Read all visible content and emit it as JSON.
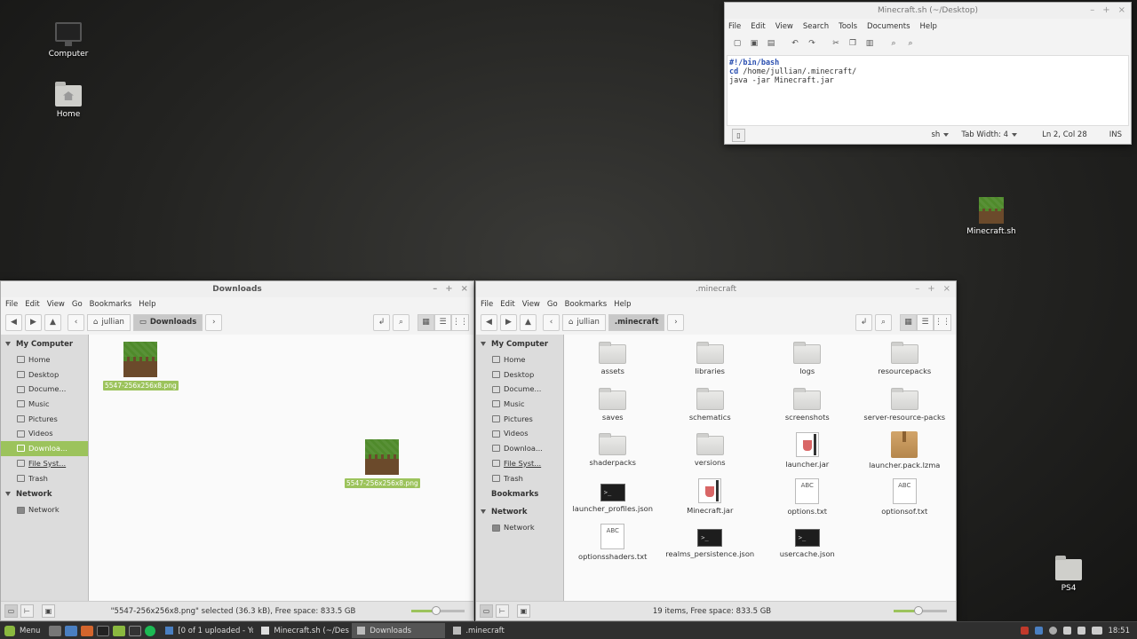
{
  "desktop": {
    "icons": {
      "computer": "Computer",
      "home": "Home",
      "minecraft_sh": "Minecraft.sh",
      "ps4": "PS4"
    }
  },
  "gedit": {
    "title": "Minecraft.sh (~/Desktop)",
    "menu": [
      "File",
      "Edit",
      "View",
      "Search",
      "Tools",
      "Documents",
      "Help"
    ],
    "code": {
      "line1": "#!/bin/bash",
      "line2_cmd": "cd",
      "line2_arg": " /home/jullian/.minecraft/",
      "line3": "java -jar Minecraft.jar"
    },
    "status": {
      "language": "sh",
      "tab_width": "Tab Width: 4",
      "position": "Ln 2, Col 28",
      "mode": "INS"
    }
  },
  "downloads_window": {
    "title": "Downloads",
    "menu": [
      "File",
      "Edit",
      "View",
      "Go",
      "Bookmarks",
      "Help"
    ],
    "breadcrumb": [
      "jullian",
      "Downloads"
    ],
    "sidebar": {
      "my_computer": "My Computer",
      "items": [
        "Home",
        "Desktop",
        "Docume...",
        "Music",
        "Pictures",
        "Videos",
        "Downloa...",
        "File Syst...",
        "Trash"
      ],
      "network_header": "Network",
      "network_items": [
        "Network"
      ]
    },
    "files": [
      "5547-256x256x8.png",
      "5547-256x256x8.png"
    ],
    "status": "\"5547-256x256x8.png\" selected (36.3 kB), Free space: 833.5 GB",
    "zoom_fraction": 0.47
  },
  "minecraft_window": {
    "title": ".minecraft",
    "menu": [
      "File",
      "Edit",
      "View",
      "Go",
      "Bookmarks",
      "Help"
    ],
    "breadcrumb": [
      "jullian",
      ".minecraft"
    ],
    "sidebar": {
      "my_computer": "My Computer",
      "items": [
        "Home",
        "Desktop",
        "Docume...",
        "Music",
        "Pictures",
        "Videos",
        "Downloa...",
        "File Syst...",
        "Trash"
      ],
      "bookmarks_header": "Bookmarks",
      "network_header": "Network",
      "network_items": [
        "Network"
      ]
    },
    "files": [
      {
        "name": "assets",
        "kind": "folder"
      },
      {
        "name": "libraries",
        "kind": "folder"
      },
      {
        "name": "logs",
        "kind": "folder"
      },
      {
        "name": "resourcepacks",
        "kind": "folder"
      },
      {
        "name": "saves",
        "kind": "folder"
      },
      {
        "name": "schematics",
        "kind": "folder"
      },
      {
        "name": "screenshots",
        "kind": "folder"
      },
      {
        "name": "server-resource-packs",
        "kind": "folder"
      },
      {
        "name": "shaderpacks",
        "kind": "folder"
      },
      {
        "name": "versions",
        "kind": "folder"
      },
      {
        "name": "launcher.jar",
        "kind": "jar"
      },
      {
        "name": "launcher.pack.lzma",
        "kind": "package"
      },
      {
        "name": "launcher_profiles.json",
        "kind": "terminal"
      },
      {
        "name": "Minecraft.jar",
        "kind": "jar"
      },
      {
        "name": "options.txt",
        "kind": "text"
      },
      {
        "name": "optionsof.txt",
        "kind": "text"
      },
      {
        "name": "optionsshaders.txt",
        "kind": "text"
      },
      {
        "name": "realms_persistence.json",
        "kind": "terminal"
      },
      {
        "name": "usercache.json",
        "kind": "terminal"
      }
    ],
    "status": "19 items, Free space: 833.5 GB",
    "zoom_fraction": 0.47
  },
  "taskbar": {
    "menu_label": "Menu",
    "tasks": [
      "[0 of 1 uploaded - Yo...",
      "Minecraft.sh (~/Des...",
      "Downloads",
      ".minecraft"
    ],
    "clock": "18:51"
  },
  "colors": {
    "accent": "#9cc35c",
    "grass": "#4f8a2b",
    "dirt": "#6b4a2b"
  }
}
